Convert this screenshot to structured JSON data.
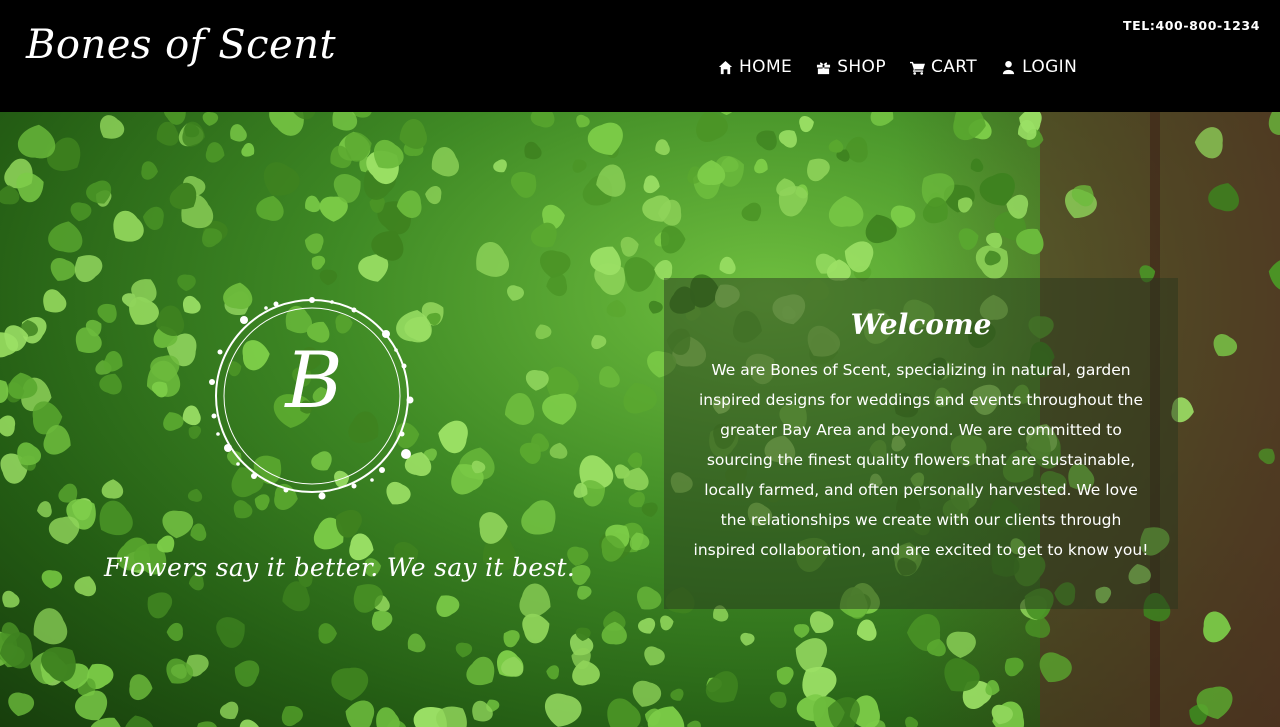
{
  "header": {
    "logo": "Bones of Scent",
    "phone": "TEL:400-800-1234",
    "nav": [
      {
        "label": "HOME",
        "icon": "home-icon"
      },
      {
        "label": "SHOP",
        "icon": "gift-icon"
      },
      {
        "label": "CART",
        "icon": "cart-icon"
      },
      {
        "label": "LOGIN",
        "icon": "user-icon"
      }
    ]
  },
  "hero": {
    "monogram_letter": "B",
    "tagline": "Flowers say it better. We say it best.",
    "welcome": {
      "title": "Welcome",
      "text": "We are Bones of Scent, specializing in natural, garden inspired designs for weddings and events throughout the greater Bay Area and beyond. We are committed to sourcing the finest quality flowers that are sustainable, locally farmed, and often personally harvested. We love the relationships we create with our clients through inspired collaboration, and are excited to get to know you!"
    }
  },
  "colors": {
    "header_bg": "#000000",
    "leaf_light": "#7ccc48",
    "leaf_dark": "#2f6e1c",
    "wood": "#5a2e26"
  }
}
